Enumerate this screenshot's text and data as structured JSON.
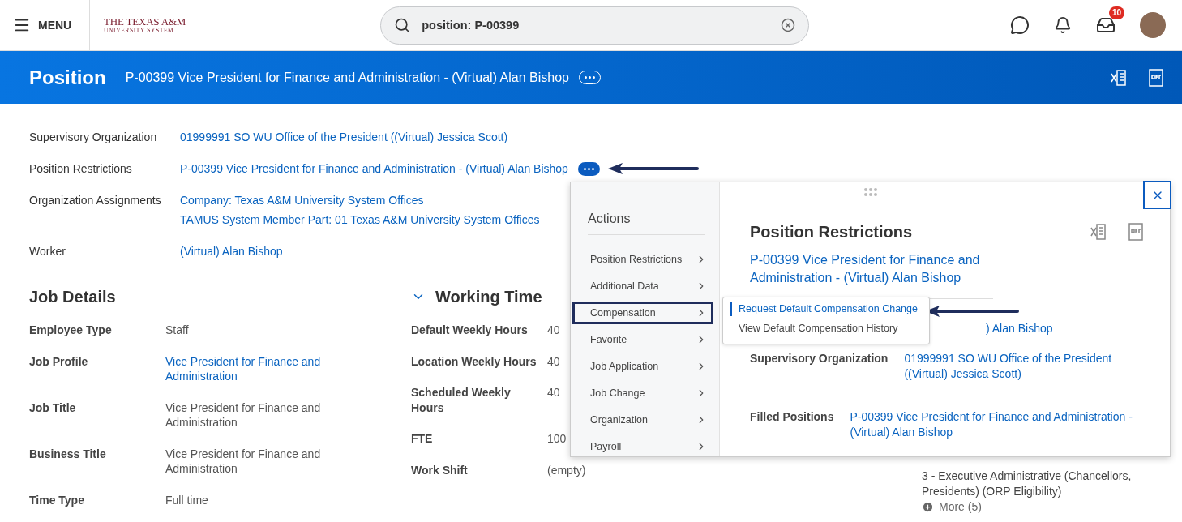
{
  "top_bar": {
    "menu_label": "MENU",
    "logo": {
      "line1": "THE TEXAS A&M",
      "line2": "UNIVERSITY SYSTEM"
    },
    "search": {
      "value": "position: P-00399"
    },
    "inbox_badge": "10"
  },
  "banner": {
    "title": "Position",
    "subtitle": "P-00399 Vice President for Finance and Administration - (Virtual) Alan Bishop"
  },
  "fields": [
    {
      "label": "Supervisory Organization",
      "values": [
        "01999991 SO WU Office of the President ((Virtual) Jessica Scott)"
      ],
      "has_actions": false
    },
    {
      "label": "Position Restrictions",
      "values": [
        "P-00399 Vice President for Finance and Administration - (Virtual) Alan Bishop"
      ],
      "has_actions": true
    },
    {
      "label": "Organization Assignments",
      "values": [
        "Company: Texas A&M University System Offices",
        "TAMUS System Member Part: 01 Texas A&M University System Offices"
      ],
      "has_actions": false
    },
    {
      "label": "Worker",
      "values": [
        "(Virtual) Alan Bishop"
      ],
      "has_actions": false
    }
  ],
  "job_details": {
    "title": "Job Details",
    "rows": [
      {
        "label": "Employee Type",
        "value": "Staff",
        "link": false
      },
      {
        "label": "Job Profile",
        "value": "Vice President for Finance and Administration",
        "link": true
      },
      {
        "label": "Job Title",
        "value": "Vice President for Finance and Administration",
        "link": false
      },
      {
        "label": "Business Title",
        "value": "Vice President for Finance and Administration",
        "link": false
      },
      {
        "label": "Time Type",
        "value": "Full time",
        "link": false
      }
    ]
  },
  "working_time": {
    "title": "Working Time",
    "expanded": true,
    "rows": [
      {
        "label": "Default Weekly Hours",
        "value": "40",
        "link": false
      },
      {
        "label": "Location Weekly Hours",
        "value": "40",
        "link": false
      },
      {
        "label": "Scheduled Weekly Hours",
        "value": "40",
        "link": false
      },
      {
        "label": "FTE",
        "value": "100",
        "link": false
      },
      {
        "label": "Work Shift",
        "value": "(empty)",
        "link": false
      }
    ]
  },
  "right_column": {
    "text": "3 - Executive Administrative (Chancellors, Presidents) (ORP Eligibility)",
    "more": "More (5)"
  },
  "actions_popup": {
    "title": "Actions",
    "items": [
      {
        "label": "Position Restrictions",
        "selected": false
      },
      {
        "label": "Additional Data",
        "selected": false
      },
      {
        "label": "Compensation",
        "selected": true
      },
      {
        "label": "Favorite",
        "selected": false
      },
      {
        "label": "Job Application",
        "selected": false
      },
      {
        "label": "Job Change",
        "selected": false
      },
      {
        "label": "Organization",
        "selected": false
      },
      {
        "label": "Payroll",
        "selected": false
      }
    ],
    "submenu": [
      {
        "label": "Request Default Compensation Change",
        "selected": true
      },
      {
        "label": "View Default Compensation History",
        "selected": false
      }
    ],
    "details": {
      "title": "Position Restrictions",
      "subtitle": "P-00399 Vice President for Finance and Administration - (Virtual) Alan Bishop",
      "partial_value": ") Alan Bishop",
      "rows": [
        {
          "label": "Supervisory Organization",
          "value": "01999991 SO WU Office of the President ((Virtual) Jessica Scott)"
        },
        {
          "label": "Filled Positions",
          "value": "P-00399 Vice President for Finance and Administration - (Virtual) Alan Bishop"
        }
      ]
    }
  }
}
